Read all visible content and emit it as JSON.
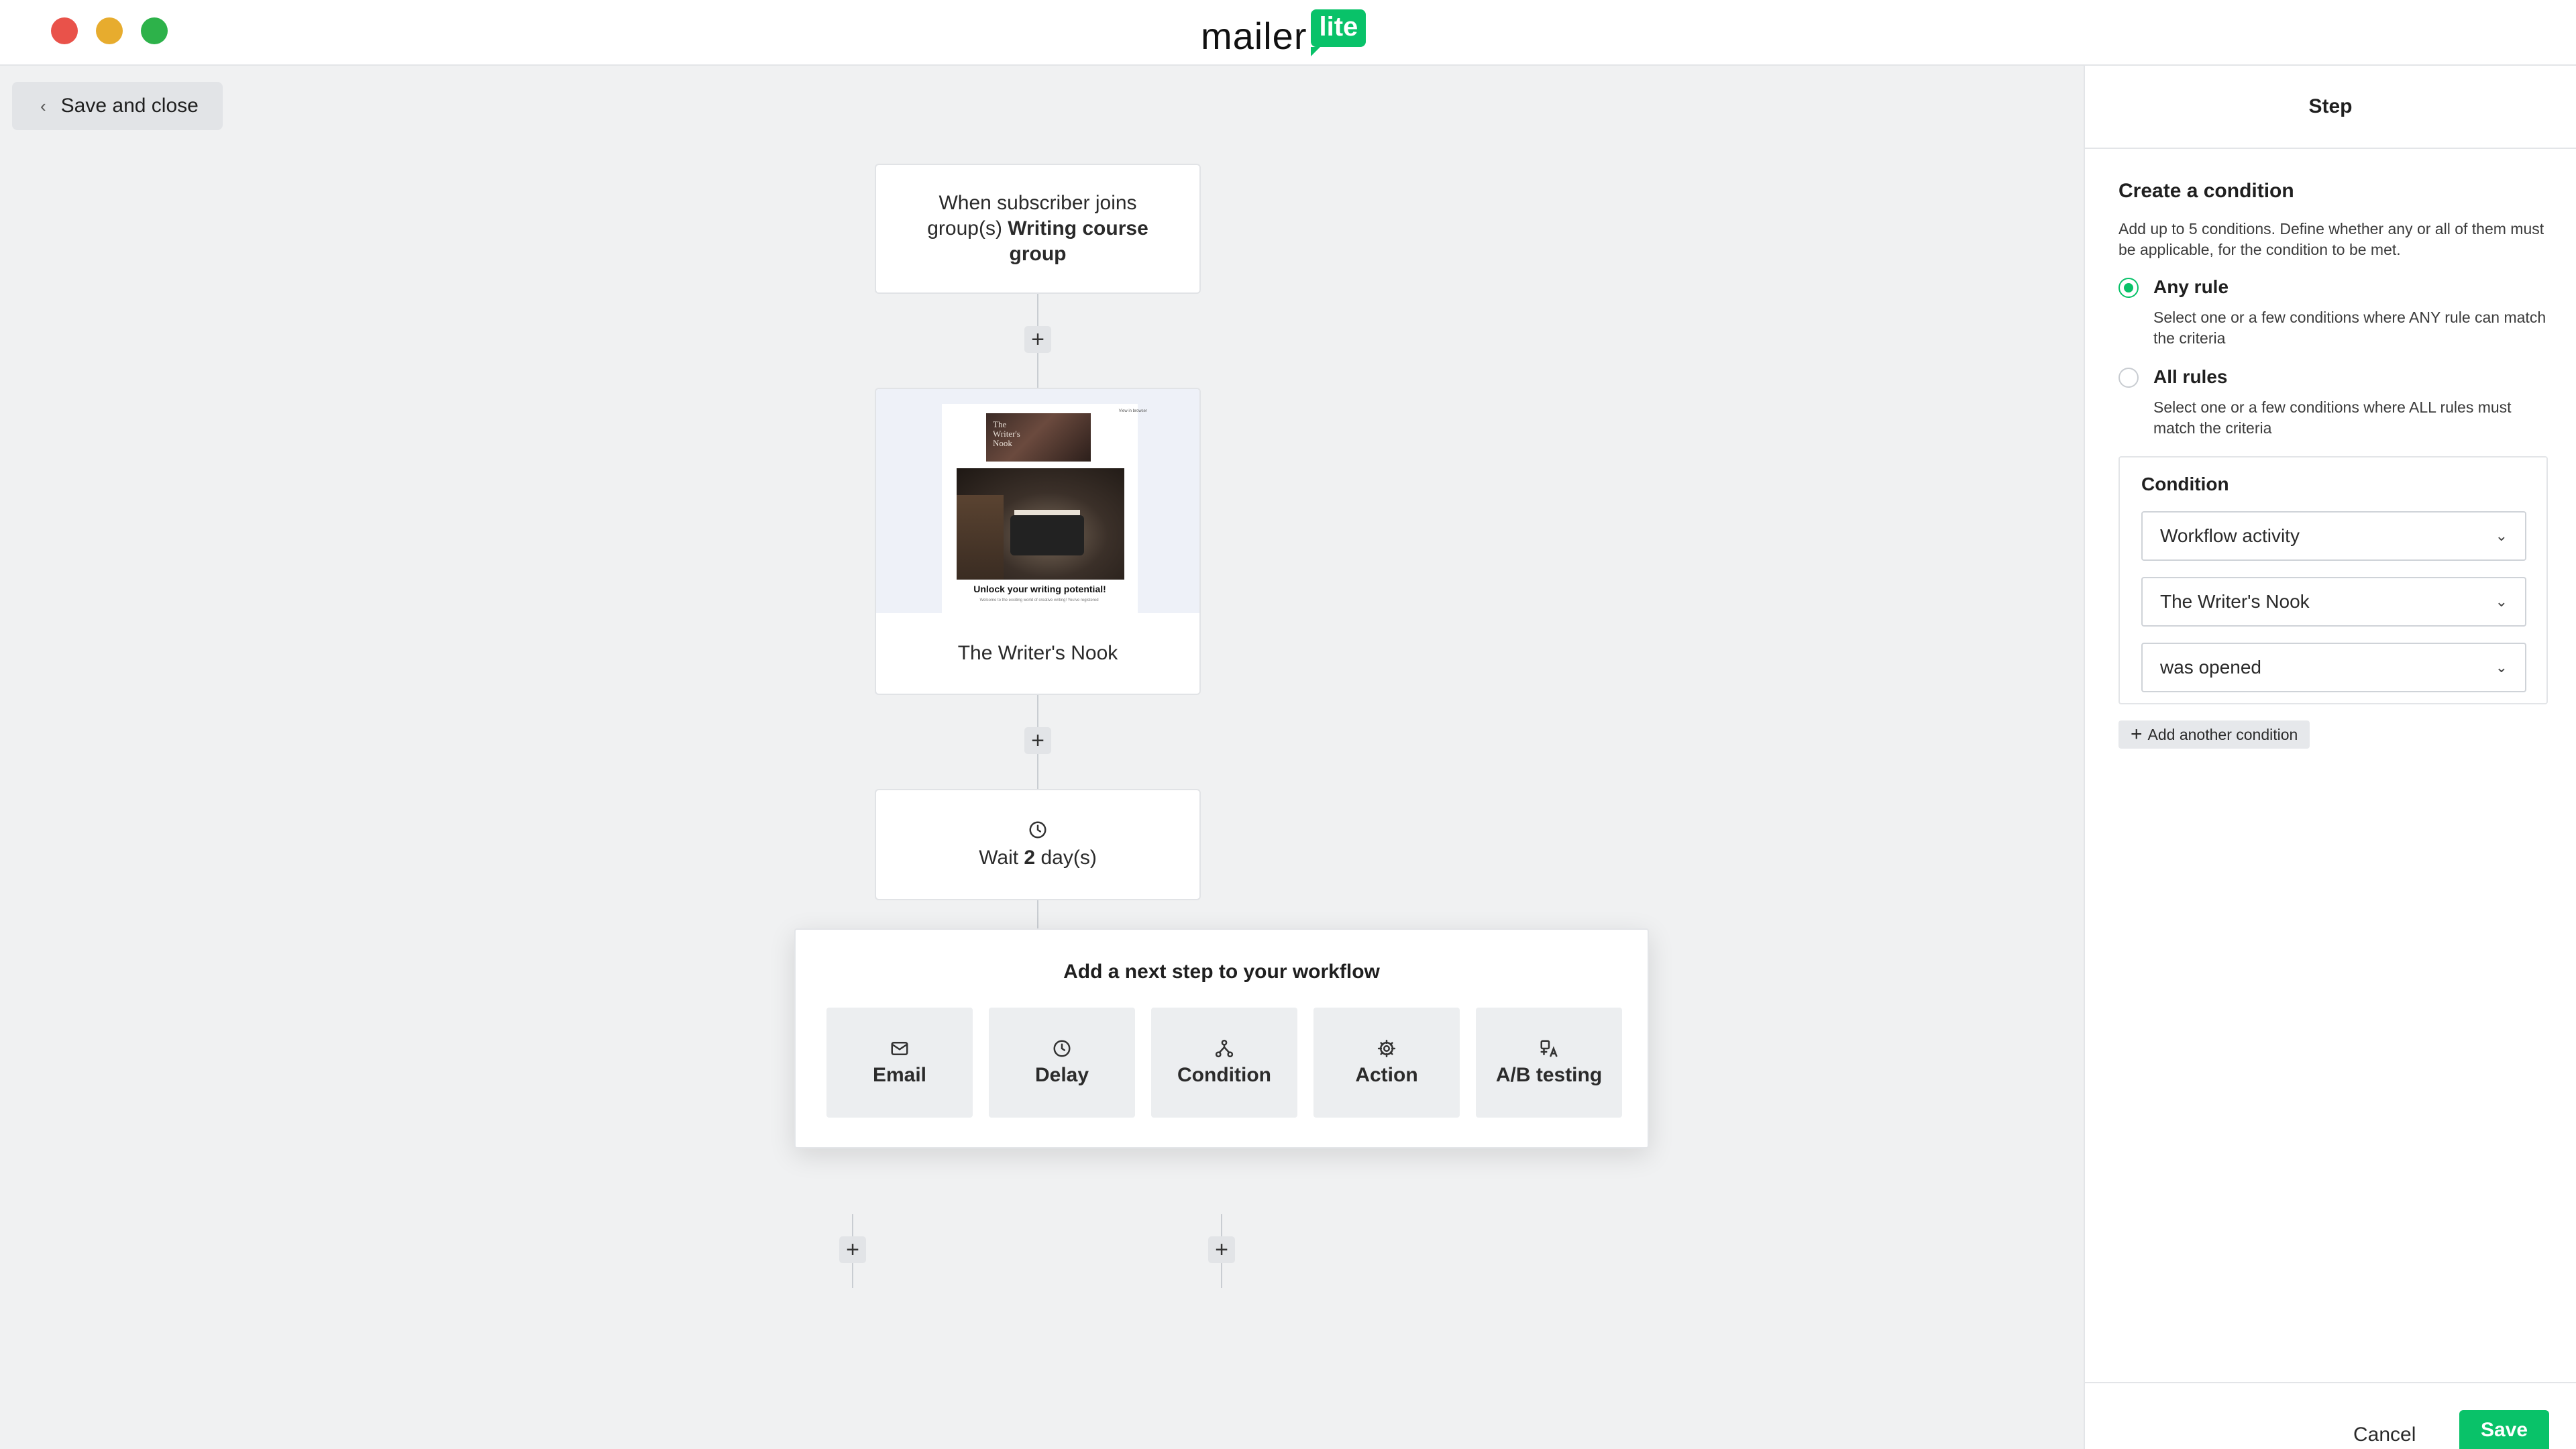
{
  "app": {
    "logo_word": "mailer",
    "logo_badge": "lite",
    "brand_color": "#09c269"
  },
  "canvas": {
    "save_close_label": "Save and close",
    "trigger": {
      "prefix": "When subscriber joins group(s)",
      "group": "Writing course group"
    },
    "email_step": {
      "name": "The Writer's Nook",
      "preview_header": "The\nWriter's\nNook",
      "preview_title": "Unlock your writing potential!",
      "preview_subtitle": "Welcome to the exciting world of creative writing! You've registered",
      "preview_link": "View in browser"
    },
    "delay_step": {
      "prefix": "Wait",
      "amount": "2",
      "unit": "day(s)"
    }
  },
  "next_step_popover": {
    "title": "Add a next step to your workflow",
    "options": [
      {
        "label": "Email",
        "icon": "envelope-icon"
      },
      {
        "label": "Delay",
        "icon": "clock-icon"
      },
      {
        "label": "Condition",
        "icon": "branch-icon"
      },
      {
        "label": "Action",
        "icon": "gear-icon"
      },
      {
        "label": "A/B testing",
        "icon": "ab-testing-icon"
      }
    ]
  },
  "panel": {
    "header": "Step",
    "section_title": "Create a condition",
    "section_desc": "Add up to 5 conditions. Define whether any or all of them must be applicable, for the condition to be met.",
    "radios": [
      {
        "label": "Any rule",
        "desc": "Select one or a few conditions where ANY rule can match the criteria",
        "checked": true
      },
      {
        "label": "All rules",
        "desc": "Select one or a few conditions where ALL rules must match the criteria",
        "checked": false
      }
    ],
    "condition": {
      "title": "Condition",
      "selects": [
        "Workflow activity",
        "The Writer's Nook",
        "was opened"
      ]
    },
    "add_condition_label": "Add another condition",
    "cancel_label": "Cancel",
    "save_label": "Save"
  }
}
